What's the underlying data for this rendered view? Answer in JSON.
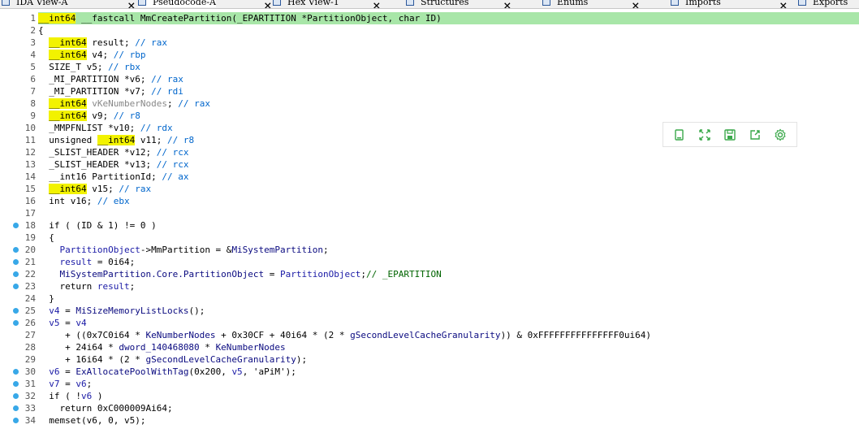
{
  "tabs": [
    {
      "label": "IDA View-A",
      "active": false
    },
    {
      "label": "Pseudocode-A",
      "active": true
    },
    {
      "label": "Hex View-1",
      "active": false
    },
    {
      "label": "Structures",
      "active": false
    },
    {
      "label": "Enums",
      "active": false
    },
    {
      "label": "Imports",
      "active": false
    },
    {
      "label": "Exports",
      "active": false
    }
  ],
  "code_lines": [
    {
      "n": "1",
      "bp": false,
      "hl": true,
      "segs": [
        {
          "t": "__int64",
          "c": "kw"
        },
        {
          "t": " __fastcall MmCreatePartition(_EPARTITION *PartitionObject, char ID)",
          "c": ""
        }
      ]
    },
    {
      "n": "2",
      "bp": false,
      "hl": false,
      "segs": [
        {
          "t": "{",
          "c": ""
        }
      ]
    },
    {
      "n": "3",
      "bp": false,
      "hl": false,
      "segs": [
        {
          "t": "  ",
          "c": ""
        },
        {
          "t": "__int64",
          "c": "kw"
        },
        {
          "t": " result; ",
          "c": ""
        },
        {
          "t": "// rax",
          "c": "cmt"
        }
      ]
    },
    {
      "n": "4",
      "bp": false,
      "hl": false,
      "segs": [
        {
          "t": "  ",
          "c": ""
        },
        {
          "t": "__int64",
          "c": "kw"
        },
        {
          "t": " v4; ",
          "c": ""
        },
        {
          "t": "// rbp",
          "c": "cmt"
        }
      ]
    },
    {
      "n": "5",
      "bp": false,
      "hl": false,
      "segs": [
        {
          "t": "  SIZE_T v5; ",
          "c": ""
        },
        {
          "t": "// rbx",
          "c": "cmt"
        }
      ]
    },
    {
      "n": "6",
      "bp": false,
      "hl": false,
      "segs": [
        {
          "t": "  _MI_PARTITION *v6; ",
          "c": ""
        },
        {
          "t": "// rax",
          "c": "cmt"
        }
      ]
    },
    {
      "n": "7",
      "bp": false,
      "hl": false,
      "segs": [
        {
          "t": "  _MI_PARTITION *v7; ",
          "c": ""
        },
        {
          "t": "// rdi",
          "c": "cmt"
        }
      ]
    },
    {
      "n": "8",
      "bp": false,
      "hl": false,
      "segs": [
        {
          "t": "  ",
          "c": ""
        },
        {
          "t": "__int64",
          "c": "kw"
        },
        {
          "t": " ",
          "c": ""
        },
        {
          "t": "vKeNumberNodes",
          "c": "grey"
        },
        {
          "t": "; ",
          "c": ""
        },
        {
          "t": "// rax",
          "c": "cmt"
        }
      ]
    },
    {
      "n": "9",
      "bp": false,
      "hl": false,
      "segs": [
        {
          "t": "  ",
          "c": ""
        },
        {
          "t": "__int64",
          "c": "kw"
        },
        {
          "t": " v9; ",
          "c": ""
        },
        {
          "t": "// r8",
          "c": "cmt"
        }
      ]
    },
    {
      "n": "10",
      "bp": false,
      "hl": false,
      "segs": [
        {
          "t": "  _MMPFNLIST *v10; ",
          "c": ""
        },
        {
          "t": "// rdx",
          "c": "cmt"
        }
      ]
    },
    {
      "n": "11",
      "bp": false,
      "hl": false,
      "segs": [
        {
          "t": "  unsigned ",
          "c": ""
        },
        {
          "t": "__int64",
          "c": "kw"
        },
        {
          "t": " v11; ",
          "c": ""
        },
        {
          "t": "// r8",
          "c": "cmt"
        }
      ]
    },
    {
      "n": "12",
      "bp": false,
      "hl": false,
      "segs": [
        {
          "t": "  _SLIST_HEADER *v12; ",
          "c": ""
        },
        {
          "t": "// rcx",
          "c": "cmt"
        }
      ]
    },
    {
      "n": "13",
      "bp": false,
      "hl": false,
      "segs": [
        {
          "t": "  _SLIST_HEADER *v13; ",
          "c": ""
        },
        {
          "t": "// rcx",
          "c": "cmt"
        }
      ]
    },
    {
      "n": "14",
      "bp": false,
      "hl": false,
      "segs": [
        {
          "t": "  __int16 PartitionId; ",
          "c": ""
        },
        {
          "t": "// ax",
          "c": "cmt"
        }
      ]
    },
    {
      "n": "15",
      "bp": false,
      "hl": false,
      "segs": [
        {
          "t": "  ",
          "c": ""
        },
        {
          "t": "__int64",
          "c": "kw"
        },
        {
          "t": " v15; ",
          "c": ""
        },
        {
          "t": "// rax",
          "c": "cmt"
        }
      ]
    },
    {
      "n": "16",
      "bp": false,
      "hl": false,
      "segs": [
        {
          "t": "  int v16; ",
          "c": ""
        },
        {
          "t": "// ebx",
          "c": "cmt"
        }
      ]
    },
    {
      "n": "17",
      "bp": false,
      "hl": false,
      "segs": [
        {
          "t": "",
          "c": ""
        }
      ]
    },
    {
      "n": "18",
      "bp": true,
      "hl": false,
      "segs": [
        {
          "t": "  if ( (ID & 1) != 0 )",
          "c": ""
        }
      ]
    },
    {
      "n": "19",
      "bp": false,
      "hl": false,
      "segs": [
        {
          "t": "  {",
          "c": ""
        }
      ]
    },
    {
      "n": "20",
      "bp": true,
      "hl": false,
      "segs": [
        {
          "t": "    ",
          "c": ""
        },
        {
          "t": "PartitionObject",
          "c": "ident"
        },
        {
          "t": "->MmPartition = &",
          "c": ""
        },
        {
          "t": "MiSystemPartition",
          "c": "fn"
        },
        {
          "t": ";",
          "c": ""
        }
      ]
    },
    {
      "n": "21",
      "bp": true,
      "hl": false,
      "segs": [
        {
          "t": "    ",
          "c": ""
        },
        {
          "t": "result",
          "c": "ident"
        },
        {
          "t": " = 0i64;",
          "c": ""
        }
      ]
    },
    {
      "n": "22",
      "bp": true,
      "hl": false,
      "segs": [
        {
          "t": "    ",
          "c": ""
        },
        {
          "t": "MiSystemPartition.Core.PartitionObject",
          "c": "fn"
        },
        {
          "t": " = ",
          "c": ""
        },
        {
          "t": "PartitionObject",
          "c": "ident"
        },
        {
          "t": ";",
          "c": ""
        },
        {
          "t": "// _EPARTITION",
          "c": "greencmt"
        }
      ]
    },
    {
      "n": "23",
      "bp": true,
      "hl": false,
      "segs": [
        {
          "t": "    return ",
          "c": ""
        },
        {
          "t": "result",
          "c": "ident"
        },
        {
          "t": ";",
          "c": ""
        }
      ]
    },
    {
      "n": "24",
      "bp": false,
      "hl": false,
      "segs": [
        {
          "t": "  }",
          "c": ""
        }
      ]
    },
    {
      "n": "25",
      "bp": true,
      "hl": false,
      "segs": [
        {
          "t": "  ",
          "c": ""
        },
        {
          "t": "v4",
          "c": "ident"
        },
        {
          "t": " = ",
          "c": ""
        },
        {
          "t": "MiSizeMemoryListLocks",
          "c": "fn"
        },
        {
          "t": "();",
          "c": ""
        }
      ]
    },
    {
      "n": "26",
      "bp": true,
      "hl": false,
      "segs": [
        {
          "t": "  ",
          "c": ""
        },
        {
          "t": "v5",
          "c": "ident"
        },
        {
          "t": " = ",
          "c": ""
        },
        {
          "t": "v4",
          "c": "ident"
        }
      ]
    },
    {
      "n": "27",
      "bp": false,
      "hl": false,
      "segs": [
        {
          "t": "     + ((0x7C0i64 * ",
          "c": ""
        },
        {
          "t": "KeNumberNodes",
          "c": "fn"
        },
        {
          "t": " + 0x30CF + 40i64 * (2 * ",
          "c": ""
        },
        {
          "t": "gSecondLevelCacheGranularity",
          "c": "fn"
        },
        {
          "t": ")) & 0xFFFFFFFFFFFFFFF0ui64)",
          "c": ""
        }
      ]
    },
    {
      "n": "28",
      "bp": false,
      "hl": false,
      "segs": [
        {
          "t": "     + 24i64 * ",
          "c": ""
        },
        {
          "t": "dword_140468080",
          "c": "fn"
        },
        {
          "t": " * ",
          "c": ""
        },
        {
          "t": "KeNumberNodes",
          "c": "fn"
        }
      ]
    },
    {
      "n": "29",
      "bp": false,
      "hl": false,
      "segs": [
        {
          "t": "     + 16i64 * (2 * ",
          "c": ""
        },
        {
          "t": "gSecondLevelCacheGranularity",
          "c": "fn"
        },
        {
          "t": ");",
          "c": ""
        }
      ]
    },
    {
      "n": "30",
      "bp": true,
      "hl": false,
      "segs": [
        {
          "t": "  ",
          "c": ""
        },
        {
          "t": "v6",
          "c": "ident"
        },
        {
          "t": " = ",
          "c": ""
        },
        {
          "t": "ExAllocatePoolWithTag",
          "c": "fn"
        },
        {
          "t": "(0x200, ",
          "c": ""
        },
        {
          "t": "v5",
          "c": "ident"
        },
        {
          "t": ", 'aPiM');",
          "c": ""
        }
      ]
    },
    {
      "n": "31",
      "bp": true,
      "hl": false,
      "segs": [
        {
          "t": "  ",
          "c": ""
        },
        {
          "t": "v7",
          "c": "ident"
        },
        {
          "t": " = ",
          "c": ""
        },
        {
          "t": "v6",
          "c": "ident"
        },
        {
          "t": ";",
          "c": ""
        }
      ]
    },
    {
      "n": "32",
      "bp": true,
      "hl": false,
      "segs": [
        {
          "t": "  if ( !",
          "c": ""
        },
        {
          "t": "v6",
          "c": "ident"
        },
        {
          "t": " )",
          "c": ""
        }
      ]
    },
    {
      "n": "33",
      "bp": true,
      "hl": false,
      "segs": [
        {
          "t": "    return 0xC000009Ai64;",
          "c": ""
        }
      ]
    },
    {
      "n": "34",
      "bp": true,
      "hl": false,
      "segs": [
        {
          "t": "  memset(v6, 0, v5);",
          "c": ""
        }
      ]
    }
  ],
  "toolbar": [
    {
      "name": "copy-icon"
    },
    {
      "name": "expand-icon"
    },
    {
      "name": "save-icon"
    },
    {
      "name": "share-icon"
    },
    {
      "name": "settings-icon"
    }
  ],
  "colors": {
    "line_highlight": "#a8e6a8",
    "keyword_bg": "#f2f200",
    "comment": "#0066cc",
    "breakpoint": "#38a8e8"
  }
}
